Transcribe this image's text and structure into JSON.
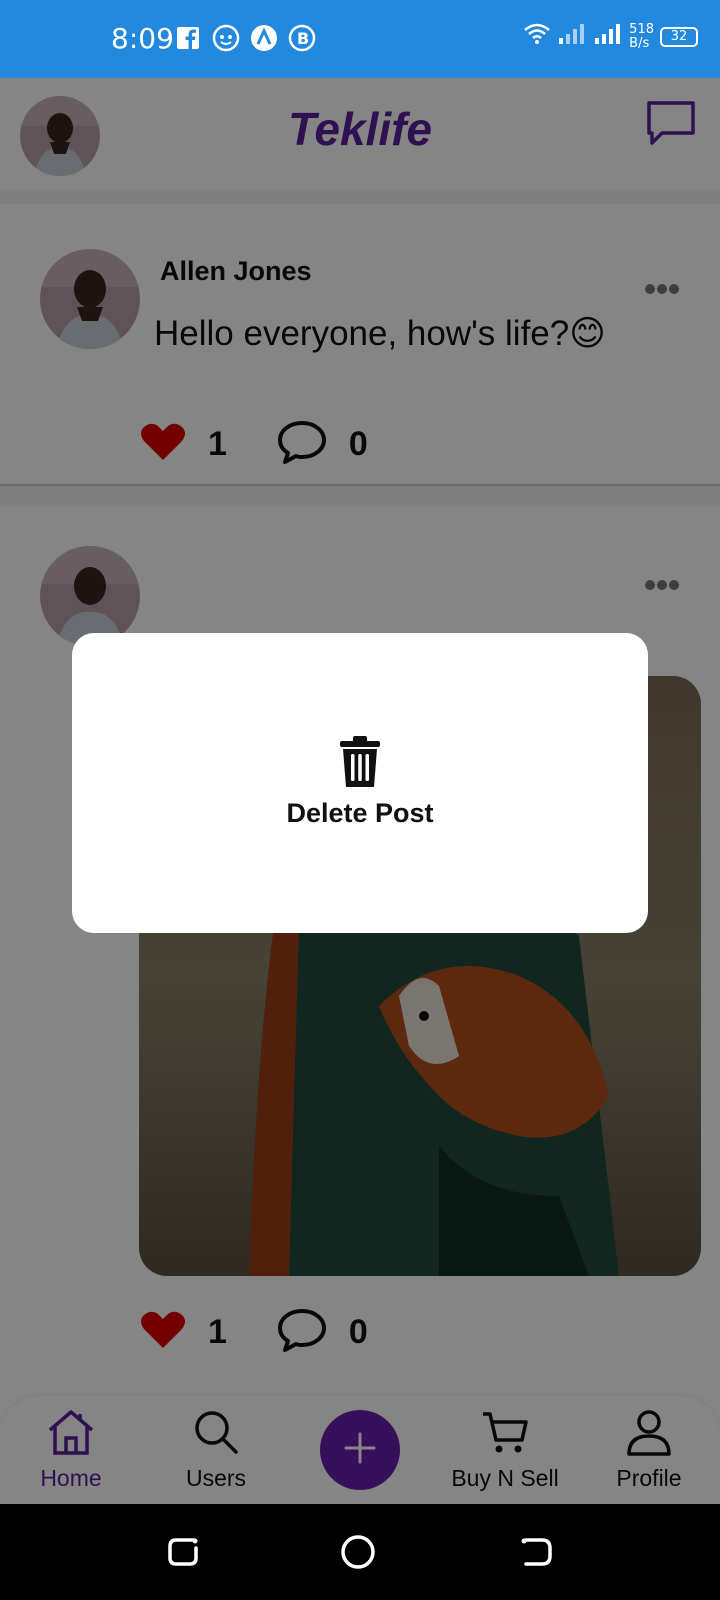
{
  "status_bar": {
    "time": "8:09",
    "net_speed_value": "518",
    "net_speed_unit": "B/s",
    "battery": "32",
    "background": "#2389df"
  },
  "header": {
    "title": "Teklife",
    "title_color": "#5b1f9a"
  },
  "posts": [
    {
      "author": "Allen Jones",
      "text": "Hello everyone, how's life?😊",
      "likes": "1",
      "comments": "0"
    },
    {
      "likes": "1",
      "comments": "0"
    }
  ],
  "bottom_nav": {
    "items": [
      {
        "label": "Home",
        "icon": "home-icon",
        "active": true
      },
      {
        "label": "Users",
        "icon": "search-icon"
      },
      {
        "label": "Buy N Sell",
        "icon": "cart-icon"
      },
      {
        "label": "Profile",
        "icon": "person-icon"
      }
    ],
    "add_icon": "plus-icon",
    "accent": "#6a1fb0"
  },
  "dialog": {
    "option_label": "Delete Post",
    "option_icon": "trash-icon"
  },
  "colors": {
    "like": "#e00000",
    "overlay": "rgba(0,0,0,0.48)"
  }
}
